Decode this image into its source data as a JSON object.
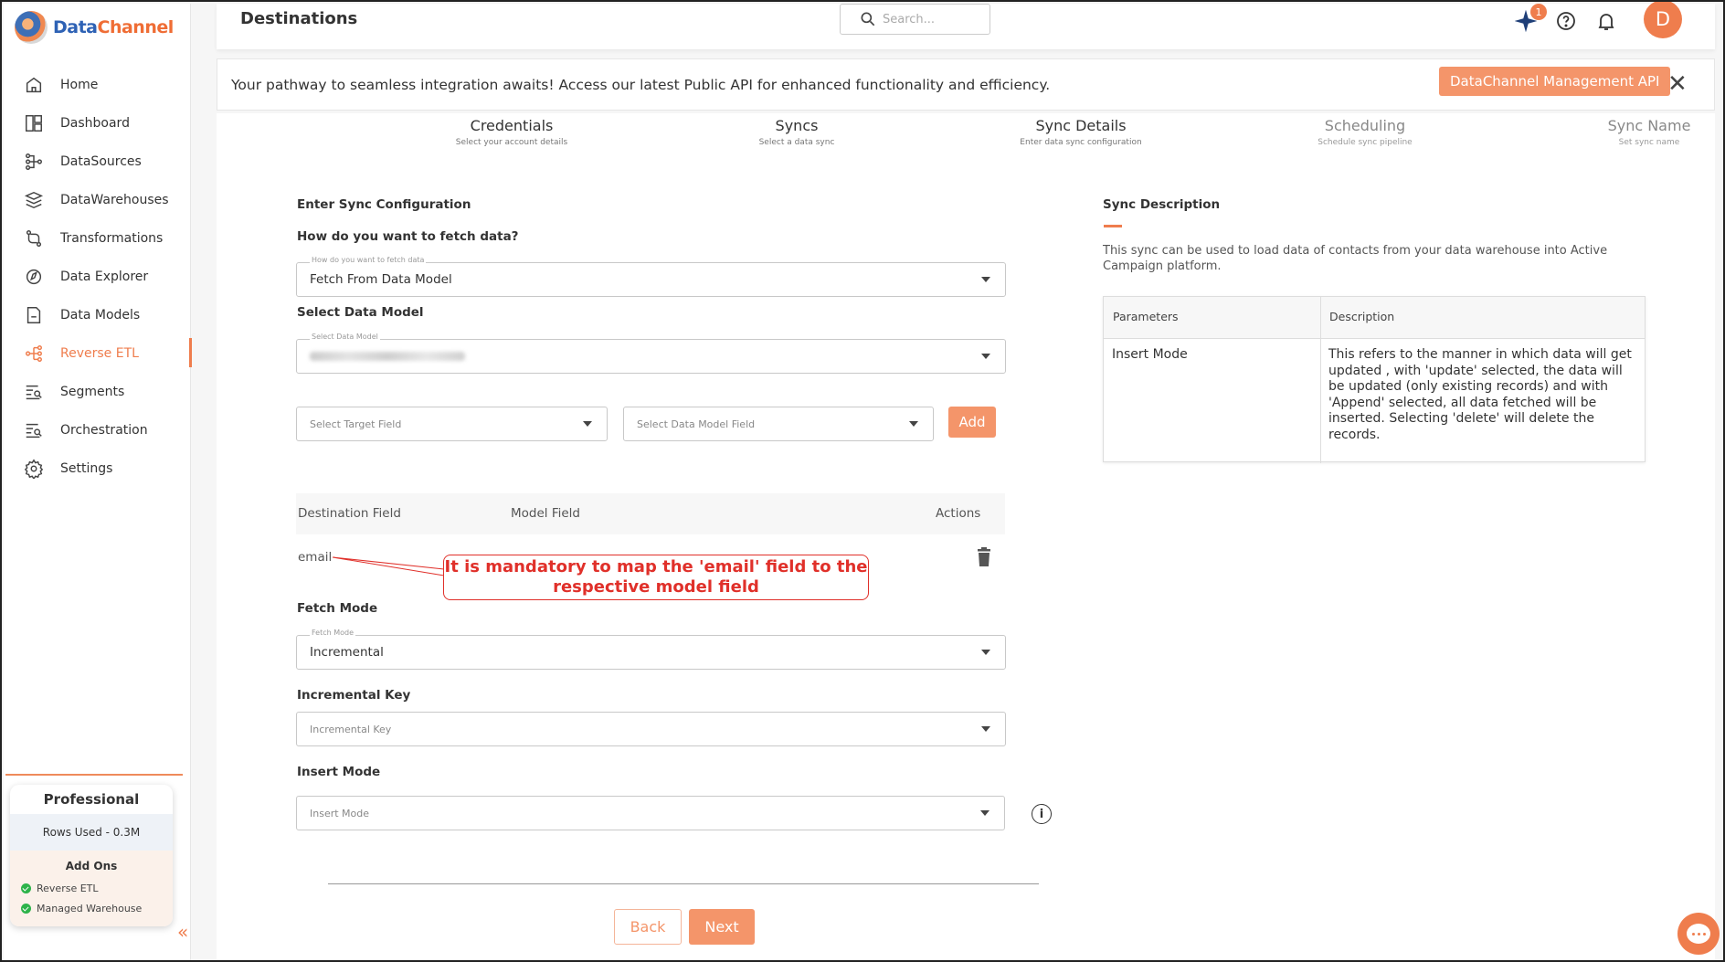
{
  "brand": {
    "name_a": "Data",
    "name_b": "Channel"
  },
  "nav": [
    {
      "label": "Home",
      "icon": "home-icon"
    },
    {
      "label": "Dashboard",
      "icon": "dashboard-icon"
    },
    {
      "label": "DataSources",
      "icon": "datasources-icon"
    },
    {
      "label": "DataWarehouses",
      "icon": "datawarehouses-icon"
    },
    {
      "label": "Transformations",
      "icon": "transformations-icon"
    },
    {
      "label": "Data Explorer",
      "icon": "data-explorer-icon"
    },
    {
      "label": "Data Models",
      "icon": "data-models-icon"
    },
    {
      "label": "Reverse ETL",
      "icon": "reverse-etl-icon",
      "active": true
    },
    {
      "label": "Segments",
      "icon": "segments-icon"
    },
    {
      "label": "Orchestration",
      "icon": "orchestration-icon"
    },
    {
      "label": "Settings",
      "icon": "gear-icon"
    }
  ],
  "plan": {
    "title": "Professional",
    "rows_used": "Rows Used - 0.3M",
    "addons_title": "Add Ons",
    "addons": [
      "Reverse ETL",
      "Managed Warehouse"
    ]
  },
  "header": {
    "title": "Destinations",
    "search_placeholder": "Search...",
    "notification_count": "1",
    "avatar_initial": "D"
  },
  "banner": {
    "text": "Your pathway to seamless integration awaits! Access our latest Public API for enhanced functionality and efficiency.",
    "button": "DataChannel Management API"
  },
  "steps": [
    {
      "title": "Credentials",
      "sub": "Select your account details"
    },
    {
      "title": "Syncs",
      "sub": "Select a data sync"
    },
    {
      "title": "Sync Details",
      "sub": "Enter data sync configuration"
    },
    {
      "title": "Scheduling",
      "sub": "Schedule sync pipeline"
    },
    {
      "title": "Sync Name",
      "sub": "Set sync name"
    }
  ],
  "form": {
    "config_heading": "Enter Sync Configuration",
    "fetch_heading": "How do you want to fetch data?",
    "fetch_label": "How do you want to fetch data",
    "fetch_value": "Fetch From Data Model",
    "model_heading": "Select Data Model",
    "model_label": "Select Data Model",
    "target_placeholder": "Select Target Field",
    "model_field_placeholder": "Select Data Model Field",
    "add_label": "Add",
    "mapping_headers": {
      "destination": "Destination Field",
      "model": "Model Field",
      "actions": "Actions"
    },
    "mapping_rows": [
      {
        "destination": "email",
        "model": ""
      }
    ],
    "callout": "It is mandatory to map the 'email'  field to the respective model field",
    "fetch_mode_heading": "Fetch Mode",
    "fetch_mode_label": "Fetch Mode",
    "fetch_mode_value": "Incremental",
    "incremental_heading": "Incremental Key",
    "incremental_placeholder": "Incremental Key",
    "insert_heading": "Insert Mode",
    "insert_placeholder": "Insert Mode",
    "back_label": "Back",
    "next_label": "Next"
  },
  "description": {
    "heading": "Sync Description",
    "text": "This sync can be used to load data of contacts from your data warehouse into Active Campaign platform.",
    "table_headers": [
      "Parameters",
      "Description"
    ],
    "rows": [
      {
        "param": "Insert Mode",
        "desc": "This refers to the manner in which data will get updated , with 'update' selected, the data will be updated (only existing records) and with 'Append' selected, all data fetched will be inserted. Selecting 'delete' will delete the records."
      }
    ]
  },
  "colors": {
    "accent": "#ef7d4d",
    "brand_blue": "#2e62b5",
    "callout_red": "#e0302a"
  }
}
